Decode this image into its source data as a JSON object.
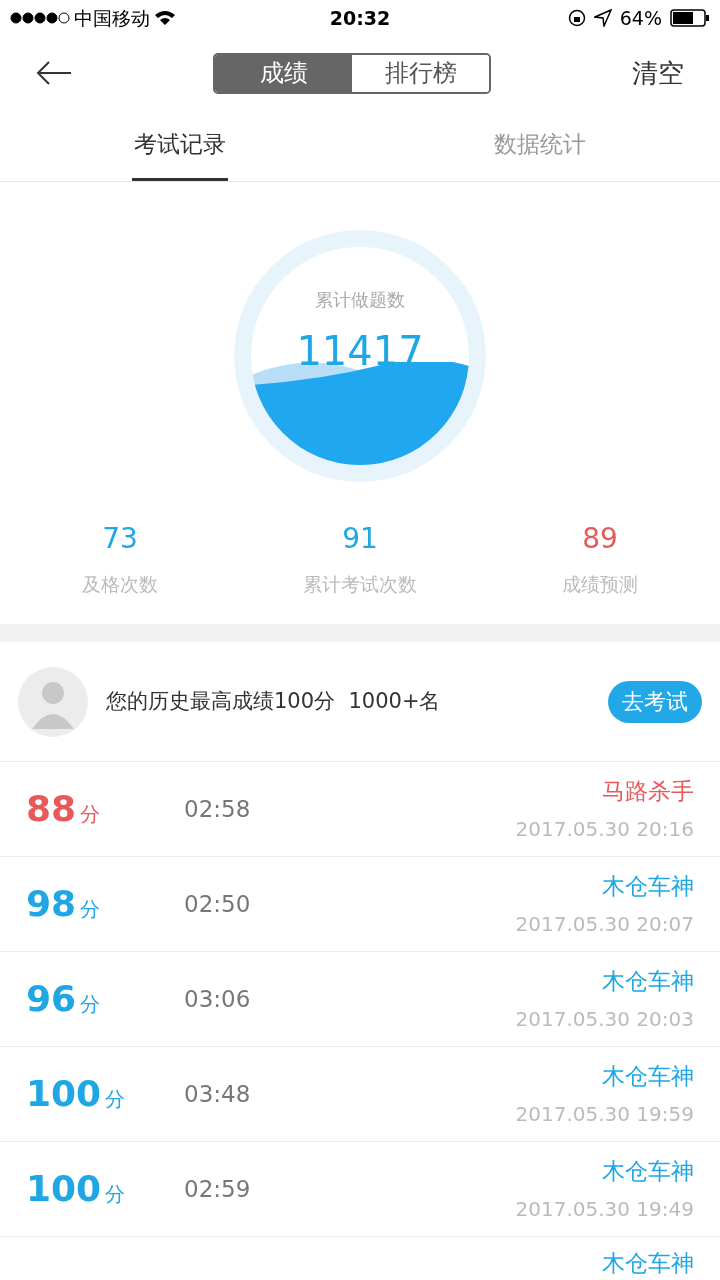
{
  "status_bar": {
    "carrier": "中国移动",
    "time": "20:32",
    "battery": "64%"
  },
  "nav": {
    "segments": [
      {
        "label": "成绩",
        "selected": true
      },
      {
        "label": "排行榜",
        "selected": false
      }
    ],
    "action": "清空"
  },
  "tabs": [
    {
      "label": "考试记录",
      "selected": true
    },
    {
      "label": "数据统计",
      "selected": false
    }
  ],
  "gauge": {
    "label": "累计做题数",
    "value": "11417"
  },
  "stats": [
    {
      "value": "73",
      "label": "及格次数",
      "passed": true
    },
    {
      "value": "91",
      "label": "累计考试次数",
      "passed": true
    },
    {
      "value": "89",
      "label": "成绩预测",
      "passed": false
    }
  ],
  "best": {
    "text": "您的历史最高成绩100分  1000+名",
    "button": "去考试"
  },
  "records": [
    {
      "score": "88",
      "unit": "分",
      "duration": "02:58",
      "title": "马路杀手",
      "date": "2017.05.30 20:16",
      "passed": false
    },
    {
      "score": "98",
      "unit": "分",
      "duration": "02:50",
      "title": "木仓车神",
      "date": "2017.05.30 20:07",
      "passed": true
    },
    {
      "score": "96",
      "unit": "分",
      "duration": "03:06",
      "title": "木仓车神",
      "date": "2017.05.30 20:03",
      "passed": true
    },
    {
      "score": "100",
      "unit": "分",
      "duration": "03:48",
      "title": "木仓车神",
      "date": "2017.05.30 19:59",
      "passed": true
    },
    {
      "score": "100",
      "unit": "分",
      "duration": "02:59",
      "title": "木仓车神",
      "date": "2017.05.30 19:49",
      "passed": true
    }
  ],
  "partial_record": {
    "title": "木仓车神",
    "passed": true
  }
}
